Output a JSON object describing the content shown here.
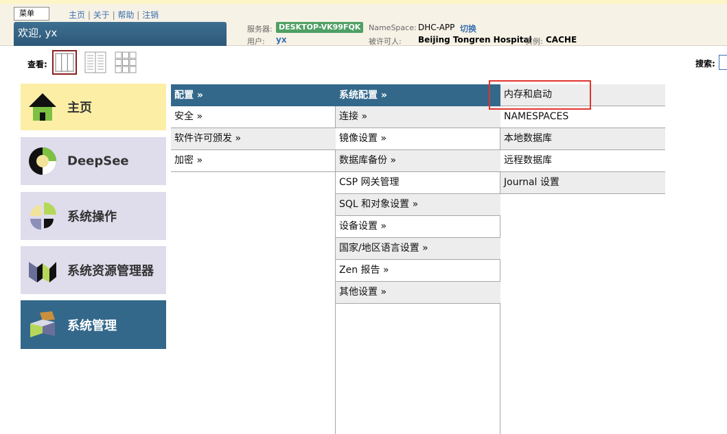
{
  "header": {
    "menu_label": "菜单",
    "links": [
      "主页",
      "关于",
      "帮助",
      "注销"
    ],
    "separator": "|",
    "welcome": "欢迎, yx",
    "server_label": "服务器:",
    "server_value": "DESKTOP-VK99FQK",
    "user_label": "用户:",
    "user_value": "yx",
    "namespace_label": "NameSpace:",
    "namespace_value": "DHC-APP",
    "switch_label": "切换",
    "licensee_label": "被许可人:",
    "licensee_value": "Beijing Tongren Hospital",
    "instance_label": "实例:",
    "instance_value": "CACHE"
  },
  "view": {
    "label": "查看:",
    "options": [
      "columns-view-icon",
      "list-view-icon",
      "grid-view-icon"
    ],
    "selected_index": 0
  },
  "search": {
    "label": "搜索:",
    "value": ""
  },
  "tiles": [
    {
      "label": "主页",
      "icon": "home-icon"
    },
    {
      "label": "DeepSee",
      "icon": "deepsee-icon"
    },
    {
      "label": "系统操作",
      "icon": "system-operation-icon"
    },
    {
      "label": "系统资源管理器",
      "icon": "system-explorer-icon"
    },
    {
      "label": "系统管理",
      "icon": "system-admin-icon",
      "selected": true
    }
  ],
  "columns": [
    {
      "header": "配置 »",
      "items": [
        "安全 »",
        "软件许可颁发 »",
        "加密 »"
      ]
    },
    {
      "header": "系统配置 »",
      "items": [
        "连接 »",
        "镜像设置 »",
        "数据库备份 »",
        "CSP 网关管理",
        "SQL 和对象设置 »",
        "设备设置 »",
        "国家/地区语言设置 »",
        "Zen 报告 »",
        "其他设置 »"
      ]
    },
    {
      "header": "",
      "items": [
        "内存和启动",
        "NAMESPACES",
        "本地数据库",
        "远程数据库",
        "Journal 设置"
      ]
    }
  ],
  "colors": {
    "header_blue": "#33688b",
    "server_badge": "#4fa064",
    "highlight_red": "#e0322c",
    "home_tile": "#fcefa5",
    "tile_lavender": "#dfddec"
  }
}
